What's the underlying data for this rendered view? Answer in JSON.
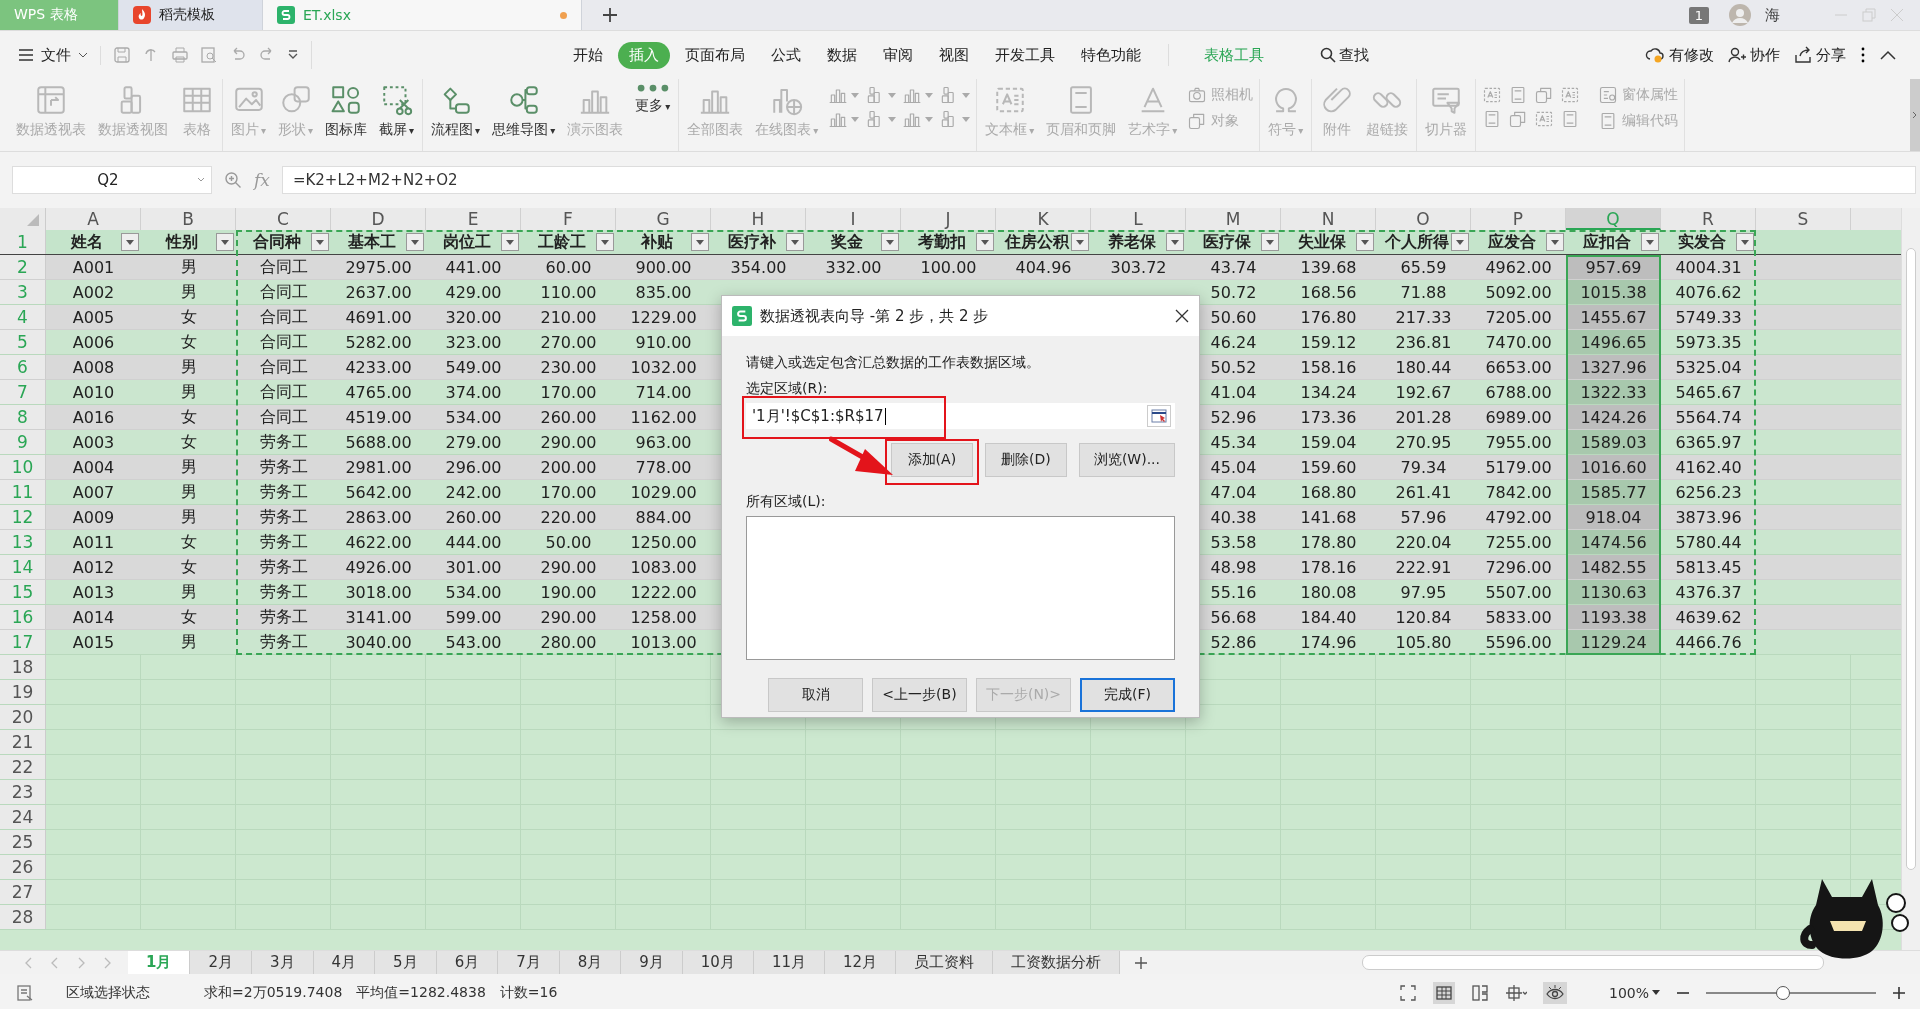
{
  "app_tabs": [
    {
      "label": "WPS 表格",
      "kind": "brand",
      "selected": false
    },
    {
      "label": "稻壳模板",
      "kind": "template",
      "selected": false
    },
    {
      "label": "ET.xlsx",
      "kind": "sheet",
      "selected": true,
      "unsaved": true
    }
  ],
  "title_right": {
    "badge": "1",
    "user": "海"
  },
  "menu": {
    "file": "文件",
    "tabs": [
      {
        "label": "开始",
        "selected": false,
        "kind": "tab"
      },
      {
        "label": "插入",
        "selected": true,
        "kind": "tab"
      },
      {
        "label": "页面布局",
        "selected": false,
        "kind": "tab"
      },
      {
        "label": "公式",
        "selected": false,
        "kind": "tab"
      },
      {
        "label": "数据",
        "selected": false,
        "kind": "tab"
      },
      {
        "label": "审阅",
        "selected": false,
        "kind": "tab"
      },
      {
        "label": "视图",
        "selected": false,
        "kind": "tab"
      },
      {
        "label": "开发工具",
        "selected": false,
        "kind": "tab"
      },
      {
        "label": "特色功能",
        "selected": false,
        "kind": "tab"
      },
      {
        "label": "表格工具",
        "selected": false,
        "kind": "context"
      }
    ],
    "search": "查找",
    "actions": [
      "有修改",
      "协作",
      "分享"
    ]
  },
  "ribbon": {
    "groups": [
      {
        "items": [
          {
            "kind": "large",
            "label": "数据透视表",
            "disabled": true
          },
          {
            "kind": "large",
            "label": "数据透视图",
            "disabled": true
          },
          {
            "kind": "large",
            "label": "表格",
            "disabled": true
          }
        ]
      },
      {
        "items": [
          {
            "kind": "large",
            "label": "图片",
            "caret": "▾",
            "disabled": true
          },
          {
            "kind": "large",
            "label": "形状",
            "caret": "▾",
            "disabled": true
          },
          {
            "kind": "large",
            "label": "图标库",
            "disabled": false
          },
          {
            "kind": "large",
            "label": "截屏",
            "caret": "▾",
            "disabled": false
          }
        ]
      },
      {
        "items": [
          {
            "kind": "large",
            "label": "流程图",
            "caret": "▾",
            "disabled": false
          },
          {
            "kind": "large",
            "label": "思维导图",
            "caret": "▾",
            "disabled": false
          },
          {
            "kind": "large",
            "label": "演示图表",
            "disabled": true
          },
          {
            "kind": "large",
            "label": "更多",
            "caret": "▾",
            "disabled": false
          }
        ]
      },
      {
        "items": [
          {
            "kind": "large",
            "label": "全部图表",
            "disabled": true
          },
          {
            "kind": "large",
            "label": "在线图表",
            "caret": "▾",
            "disabled": true
          },
          {
            "kind": "chart_grid"
          }
        ]
      },
      {
        "items": [
          {
            "kind": "large",
            "label": "文本框",
            "caret": "▾",
            "disabled": true
          },
          {
            "kind": "large",
            "label": "页眉和页脚",
            "disabled": true
          },
          {
            "kind": "large",
            "label": "艺术字",
            "caret": "▾",
            "disabled": true
          },
          {
            "kind": "small",
            "label": "照相机",
            "disabled": true
          },
          {
            "kind": "small",
            "label": "对象",
            "disabled": true
          }
        ]
      },
      {
        "items": [
          {
            "kind": "large",
            "label": "符号",
            "caret": "▾",
            "disabled": true
          }
        ]
      },
      {
        "items": [
          {
            "kind": "large",
            "label": "附件",
            "disabled": true
          },
          {
            "kind": "large",
            "label": "超链接",
            "disabled": true
          }
        ]
      },
      {
        "items": [
          {
            "kind": "large",
            "label": "切片器",
            "disabled": true
          }
        ]
      },
      {
        "items": [
          {
            "kind": "form_grid"
          },
          {
            "kind": "small",
            "label": "窗体属性",
            "disabled": true
          },
          {
            "kind": "small",
            "label": "编辑代码",
            "disabled": true
          }
        ]
      }
    ]
  },
  "formula_bar": {
    "cell": "Q2",
    "fx": "fx",
    "formula": "=K2+L2+M2+N2+O2"
  },
  "sheet": {
    "columns": [
      {
        "letter": "A",
        "selected": false
      },
      {
        "letter": "B",
        "selected": false
      },
      {
        "letter": "C",
        "selected": false
      },
      {
        "letter": "D",
        "selected": false
      },
      {
        "letter": "E",
        "selected": false
      },
      {
        "letter": "F",
        "selected": false
      },
      {
        "letter": "G",
        "selected": false
      },
      {
        "letter": "H",
        "selected": false
      },
      {
        "letter": "I",
        "selected": false
      },
      {
        "letter": "J",
        "selected": false
      },
      {
        "letter": "K",
        "selected": false
      },
      {
        "letter": "L",
        "selected": false
      },
      {
        "letter": "M",
        "selected": false
      },
      {
        "letter": "N",
        "selected": false
      },
      {
        "letter": "O",
        "selected": false
      },
      {
        "letter": "P",
        "selected": false
      },
      {
        "letter": "Q",
        "selected": true
      },
      {
        "letter": "R",
        "selected": false
      },
      {
        "letter": "S",
        "selected": false
      }
    ],
    "header_row": {
      "label": "1",
      "cells": [
        "姓名",
        "性别",
        "合同种",
        "基本工",
        "岗位工",
        "工龄工",
        "补贴",
        "医疗补",
        "奖金",
        "考勤扣",
        "住房公积",
        "养老保",
        "医疗保",
        "失业保",
        "个人所得",
        "应发合",
        "应扣合",
        "实发合"
      ]
    },
    "rows": [
      {
        "label": "2",
        "cells": [
          "A001",
          "男",
          "合同工",
          "2975.00",
          "441.00",
          "60.00",
          "900.00",
          "354.00",
          "332.00",
          "100.00",
          "404.96",
          "303.72",
          "43.74",
          "139.68",
          "65.59",
          "4962.00",
          "957.69",
          "4004.31"
        ]
      },
      {
        "label": "3",
        "cells": [
          "A002",
          "男",
          "合同工",
          "2637.00",
          "429.00",
          "110.00",
          "835.00",
          null,
          null,
          null,
          null,
          null,
          "50.72",
          "168.56",
          "71.88",
          "5092.00",
          "1015.38",
          "4076.62"
        ]
      },
      {
        "label": "4",
        "cells": [
          "A005",
          "女",
          "合同工",
          "4691.00",
          "320.00",
          "210.00",
          "1229.00",
          null,
          null,
          null,
          null,
          null,
          "50.60",
          "176.80",
          "217.33",
          "7205.00",
          "1455.67",
          "5749.33"
        ]
      },
      {
        "label": "5",
        "cells": [
          "A006",
          "女",
          "合同工",
          "5282.00",
          "323.00",
          "270.00",
          "910.00",
          null,
          null,
          null,
          null,
          null,
          "46.24",
          "159.12",
          "236.81",
          "7470.00",
          "1496.65",
          "5973.35"
        ]
      },
      {
        "label": "6",
        "cells": [
          "A008",
          "男",
          "合同工",
          "4233.00",
          "549.00",
          "230.00",
          "1032.00",
          null,
          null,
          null,
          null,
          null,
          "50.52",
          "158.16",
          "180.44",
          "6653.00",
          "1327.96",
          "5325.04"
        ]
      },
      {
        "label": "7",
        "cells": [
          "A010",
          "男",
          "合同工",
          "4765.00",
          "374.00",
          "170.00",
          "714.00",
          null,
          null,
          null,
          null,
          null,
          "41.04",
          "134.24",
          "192.67",
          "6788.00",
          "1322.33",
          "5465.67"
        ]
      },
      {
        "label": "8",
        "cells": [
          "A016",
          "女",
          "合同工",
          "4519.00",
          "534.00",
          "260.00",
          "1162.00",
          null,
          null,
          null,
          null,
          null,
          "52.96",
          "173.36",
          "201.28",
          "6989.00",
          "1424.26",
          "5564.74"
        ]
      },
      {
        "label": "9",
        "cells": [
          "A003",
          "女",
          "劳务工",
          "5688.00",
          "279.00",
          "290.00",
          "963.00",
          null,
          null,
          null,
          null,
          null,
          "45.34",
          "159.04",
          "270.95",
          "7955.00",
          "1589.03",
          "6365.97"
        ]
      },
      {
        "label": "10",
        "cells": [
          "A004",
          "男",
          "劳务工",
          "2981.00",
          "296.00",
          "200.00",
          "778.00",
          null,
          null,
          null,
          null,
          null,
          "45.04",
          "159.60",
          "79.34",
          "5179.00",
          "1016.60",
          "4162.40"
        ]
      },
      {
        "label": "11",
        "cells": [
          "A007",
          "男",
          "劳务工",
          "5642.00",
          "242.00",
          "170.00",
          "1029.00",
          null,
          null,
          null,
          null,
          null,
          "47.04",
          "168.80",
          "261.41",
          "7842.00",
          "1585.77",
          "6256.23"
        ]
      },
      {
        "label": "12",
        "cells": [
          "A009",
          "男",
          "劳务工",
          "2863.00",
          "260.00",
          "220.00",
          "884.00",
          null,
          null,
          null,
          null,
          null,
          "40.38",
          "141.68",
          "57.96",
          "4792.00",
          "918.04",
          "3873.96"
        ]
      },
      {
        "label": "13",
        "cells": [
          "A011",
          "女",
          "劳务工",
          "4622.00",
          "444.00",
          "50.00",
          "1250.00",
          null,
          null,
          null,
          null,
          null,
          "53.58",
          "178.80",
          "220.04",
          "7255.00",
          "1474.56",
          "5780.44"
        ]
      },
      {
        "label": "14",
        "cells": [
          "A012",
          "女",
          "劳务工",
          "4926.00",
          "301.00",
          "290.00",
          "1083.00",
          null,
          null,
          null,
          null,
          null,
          "48.98",
          "178.16",
          "222.91",
          "7296.00",
          "1482.55",
          "5813.45"
        ]
      },
      {
        "label": "15",
        "cells": [
          "A013",
          "男",
          "劳务工",
          "3018.00",
          "534.00",
          "190.00",
          "1222.00",
          null,
          null,
          null,
          null,
          null,
          "55.16",
          "180.08",
          "97.95",
          "5507.00",
          "1130.63",
          "4376.37"
        ]
      },
      {
        "label": "16",
        "cells": [
          "A014",
          "女",
          "劳务工",
          "3141.00",
          "599.00",
          "290.00",
          "1258.00",
          null,
          null,
          null,
          null,
          null,
          "56.68",
          "184.40",
          "120.84",
          "5833.00",
          "1193.38",
          "4639.62"
        ]
      },
      {
        "label": "17",
        "cells": [
          "A015",
          "男",
          "劳务工",
          "3040.00",
          "543.00",
          "280.00",
          "1013.00",
          null,
          null,
          null,
          null,
          null,
          "52.86",
          "174.96",
          "105.80",
          "5596.00",
          "1129.24",
          "4466.76"
        ]
      },
      {
        "label": "18"
      },
      {
        "label": "19"
      },
      {
        "label": "20"
      },
      {
        "label": "21"
      },
      {
        "label": "22"
      },
      {
        "label": "23"
      },
      {
        "label": "24"
      },
      {
        "label": "25"
      },
      {
        "label": "26"
      },
      {
        "label": "27"
      },
      {
        "label": "28"
      }
    ]
  },
  "dialog": {
    "title": "数据透视表向导 -第 2 步，共 2 步",
    "instruction": "请键入或选定包含汇总数据的工作表数据区域。",
    "range_label": "选定区域(R):",
    "range_value": "'1月'!$C$1:$R$17",
    "range_highlighted": true,
    "range_buttons": [
      {
        "label": "添加(A)",
        "highlighted": true
      },
      {
        "label": "删除(D)",
        "highlighted": false
      },
      {
        "label": "浏览(W)...",
        "highlighted": false
      }
    ],
    "all_label": "所有区域(L):",
    "footer_buttons": [
      {
        "label": "取消",
        "disabled": false,
        "default": false
      },
      {
        "label": "<上一步(B)",
        "disabled": false,
        "default": false
      },
      {
        "label": "下一步(N)>",
        "disabled": true,
        "default": false
      },
      {
        "label": "完成(F)",
        "disabled": false,
        "default": true
      }
    ]
  },
  "sheet_tabs": [
    {
      "label": "1月",
      "selected": true
    },
    {
      "label": "2月",
      "selected": false
    },
    {
      "label": "3月",
      "selected": false
    },
    {
      "label": "4月",
      "selected": false
    },
    {
      "label": "5月",
      "selected": false
    },
    {
      "label": "6月",
      "selected": false
    },
    {
      "label": "7月",
      "selected": false
    },
    {
      "label": "8月",
      "selected": false
    },
    {
      "label": "9月",
      "selected": false
    },
    {
      "label": "10月",
      "selected": false
    },
    {
      "label": "11月",
      "selected": false
    },
    {
      "label": "12月",
      "selected": false
    },
    {
      "label": "员工资料",
      "selected": false
    },
    {
      "label": "工资数据分析",
      "selected": false
    }
  ],
  "status_bar": {
    "mode": "区域选择状态",
    "stats": [
      "求和=2万0519.7408",
      "平均值=1282.4838",
      "计数=16"
    ],
    "zoom": "100%",
    "zoom_slider": {
      "level": 0.45
    }
  }
}
